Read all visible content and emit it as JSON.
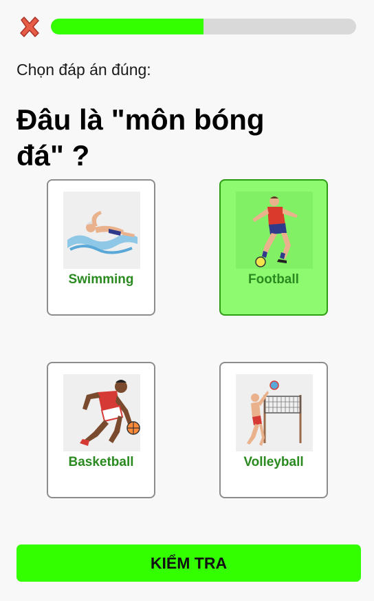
{
  "header": {
    "close_icon": "close-x-icon",
    "progress_fraction": 0.5,
    "progress_color": "#33ff00",
    "progress_track_color": "#d9d9d9"
  },
  "quiz": {
    "instruction": "Chọn đáp án đúng:",
    "question": "Đâu là \"môn bóng đá\" ?",
    "options": [
      {
        "label": "Swimming",
        "icon": "swimmer-icon",
        "selected": false
      },
      {
        "label": "Football",
        "icon": "football-player-icon",
        "selected": true
      },
      {
        "label": "Basketball",
        "icon": "basketball-player-icon",
        "selected": false
      },
      {
        "label": "Volleyball",
        "icon": "volleyball-player-icon",
        "selected": false
      }
    ]
  },
  "footer": {
    "check_label": "KIỂM TRA",
    "button_color": "#33ff00"
  },
  "colors": {
    "selected_card": "#8dfa70",
    "label_green": "#2a8a1f"
  }
}
